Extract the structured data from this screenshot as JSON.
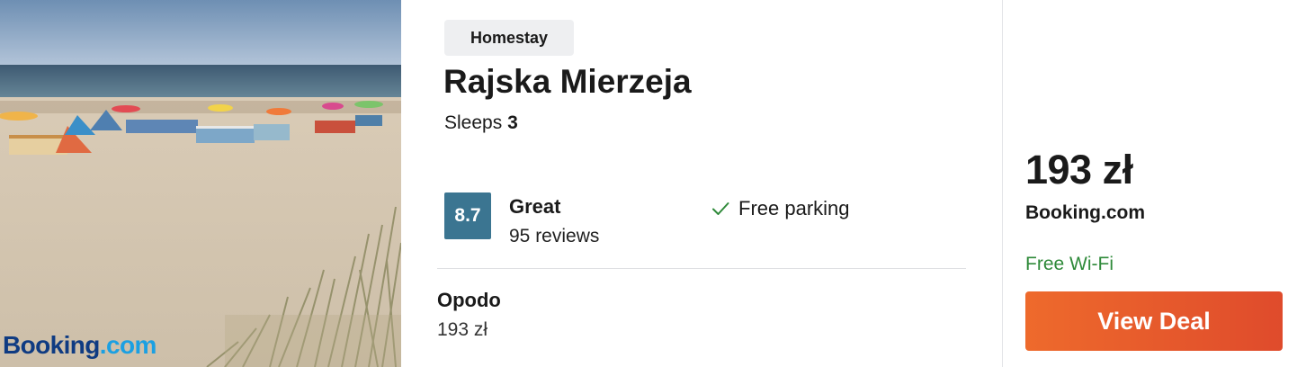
{
  "photo": {
    "alt": "Beach with windbreaks, umbrellas and dune grass",
    "watermark_part1": "Booking",
    "watermark_part2": ".com"
  },
  "listing": {
    "type_badge": "Homestay",
    "name": "Rajska Mierzeja",
    "sleeps_label": "Sleeps",
    "sleeps_count": "3",
    "rating": {
      "score": "8.7",
      "word": "Great",
      "reviews": "95 reviews",
      "color": "#3b7591"
    },
    "amenity": {
      "icon": "check-icon",
      "label": "Free parking"
    }
  },
  "alt_offer": {
    "provider": "Opodo",
    "price": "193 zł"
  },
  "deal": {
    "price": "193 zł",
    "provider": "Booking.com",
    "perk": "Free Wi-Fi",
    "perk_color": "#2f8a3a",
    "button_label": "View Deal",
    "button_color": "#e85a2c"
  }
}
